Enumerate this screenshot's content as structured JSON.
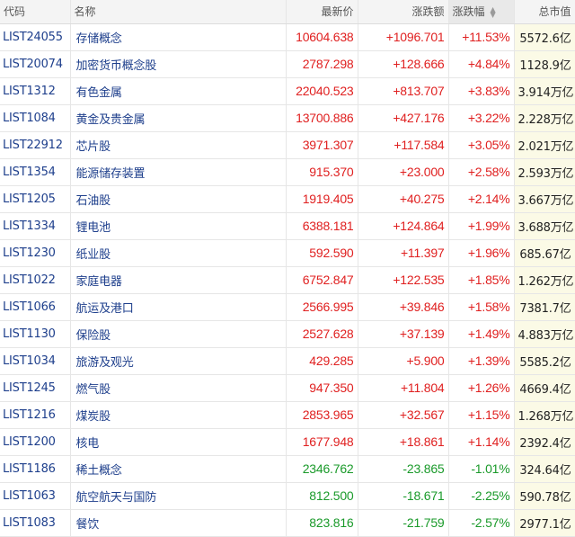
{
  "table": {
    "columns": {
      "code": "代码",
      "name": "名称",
      "price": "最新价",
      "change": "涨跌额",
      "pct": "涨跌幅",
      "cap": "总市值"
    },
    "rows": [
      {
        "code": "LIST24055",
        "name": "存储概念",
        "price": "10604.638",
        "change": "+1096.701",
        "pct": "+11.53%",
        "cap": "5572.6亿",
        "dir": "up"
      },
      {
        "code": "LIST20074",
        "name": "加密货币概念股",
        "price": "2787.298",
        "change": "+128.666",
        "pct": "+4.84%",
        "cap": "1128.9亿",
        "dir": "up"
      },
      {
        "code": "LIST1312",
        "name": "有色金属",
        "price": "22040.523",
        "change": "+813.707",
        "pct": "+3.83%",
        "cap": "3.914万亿",
        "dir": "up"
      },
      {
        "code": "LIST1084",
        "name": "黄金及贵金属",
        "price": "13700.886",
        "change": "+427.176",
        "pct": "+3.22%",
        "cap": "2.228万亿",
        "dir": "up"
      },
      {
        "code": "LIST22912",
        "name": "芯片股",
        "price": "3971.307",
        "change": "+117.584",
        "pct": "+3.05%",
        "cap": "2.021万亿",
        "dir": "up"
      },
      {
        "code": "LIST1354",
        "name": "能源储存装置",
        "price": "915.370",
        "change": "+23.000",
        "pct": "+2.58%",
        "cap": "2.593万亿",
        "dir": "up"
      },
      {
        "code": "LIST1205",
        "name": "石油股",
        "price": "1919.405",
        "change": "+40.275",
        "pct": "+2.14%",
        "cap": "3.667万亿",
        "dir": "up"
      },
      {
        "code": "LIST1334",
        "name": "锂电池",
        "price": "6388.181",
        "change": "+124.864",
        "pct": "+1.99%",
        "cap": "3.688万亿",
        "dir": "up"
      },
      {
        "code": "LIST1230",
        "name": "纸业股",
        "price": "592.590",
        "change": "+11.397",
        "pct": "+1.96%",
        "cap": "685.67亿",
        "dir": "up"
      },
      {
        "code": "LIST1022",
        "name": "家庭电器",
        "price": "6752.847",
        "change": "+122.535",
        "pct": "+1.85%",
        "cap": "1.262万亿",
        "dir": "up"
      },
      {
        "code": "LIST1066",
        "name": "航运及港口",
        "price": "2566.995",
        "change": "+39.846",
        "pct": "+1.58%",
        "cap": "7381.7亿",
        "dir": "up"
      },
      {
        "code": "LIST1130",
        "name": "保险股",
        "price": "2527.628",
        "change": "+37.139",
        "pct": "+1.49%",
        "cap": "4.883万亿",
        "dir": "up"
      },
      {
        "code": "LIST1034",
        "name": "旅游及观光",
        "price": "429.285",
        "change": "+5.900",
        "pct": "+1.39%",
        "cap": "5585.2亿",
        "dir": "up"
      },
      {
        "code": "LIST1245",
        "name": "燃气股",
        "price": "947.350",
        "change": "+11.804",
        "pct": "+1.26%",
        "cap": "4669.4亿",
        "dir": "up"
      },
      {
        "code": "LIST1216",
        "name": "煤炭股",
        "price": "2853.965",
        "change": "+32.567",
        "pct": "+1.15%",
        "cap": "1.268万亿",
        "dir": "up"
      },
      {
        "code": "LIST1200",
        "name": "核电",
        "price": "1677.948",
        "change": "+18.861",
        "pct": "+1.14%",
        "cap": "2392.4亿",
        "dir": "up"
      },
      {
        "code": "LIST1186",
        "name": "稀土概念",
        "price": "2346.762",
        "change": "-23.865",
        "pct": "-1.01%",
        "cap": "324.64亿",
        "dir": "down"
      },
      {
        "code": "LIST1063",
        "name": "航空航天与国防",
        "price": "812.500",
        "change": "-18.671",
        "pct": "-2.25%",
        "cap": "590.78亿",
        "dir": "down"
      },
      {
        "code": "LIST1083",
        "name": "餐饮",
        "price": "823.816",
        "change": "-21.759",
        "pct": "-2.57%",
        "cap": "2977.1亿",
        "dir": "down"
      }
    ]
  },
  "colors": {
    "up": "#e02020",
    "down": "#1a9a2a",
    "link": "#1e3f8c",
    "header_bg": "#f4f4f4",
    "cap_bg": "#fbfae6"
  },
  "icons": {
    "sort": "sort-arrows-icon"
  }
}
